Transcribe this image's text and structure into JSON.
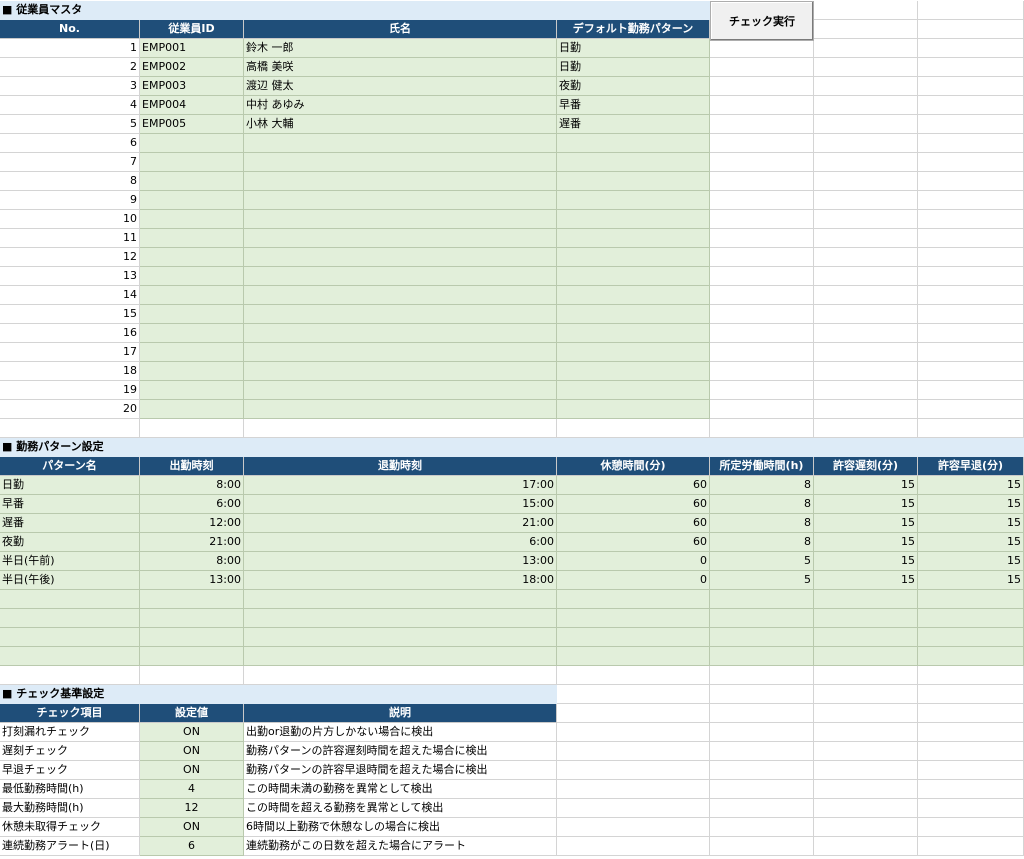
{
  "employee_section": {
    "title": "■ 従業員マスタ",
    "headers": [
      "No.",
      "従業員ID",
      "氏名",
      "デフォルト勤務パターン"
    ],
    "rows": [
      [
        "1",
        "EMP001",
        "鈴木 一郎",
        "日勤"
      ],
      [
        "2",
        "EMP002",
        "高橋 美咲",
        "日勤"
      ],
      [
        "3",
        "EMP003",
        "渡辺 健太",
        "夜勤"
      ],
      [
        "4",
        "EMP004",
        "中村 あゆみ",
        "早番"
      ],
      [
        "5",
        "EMP005",
        "小林 大輔",
        "遅番"
      ],
      [
        "6",
        "",
        "",
        ""
      ],
      [
        "7",
        "",
        "",
        ""
      ],
      [
        "8",
        "",
        "",
        ""
      ],
      [
        "9",
        "",
        "",
        ""
      ],
      [
        "10",
        "",
        "",
        ""
      ],
      [
        "11",
        "",
        "",
        ""
      ],
      [
        "12",
        "",
        "",
        ""
      ],
      [
        "13",
        "",
        "",
        ""
      ],
      [
        "14",
        "",
        "",
        ""
      ],
      [
        "15",
        "",
        "",
        ""
      ],
      [
        "16",
        "",
        "",
        ""
      ],
      [
        "17",
        "",
        "",
        ""
      ],
      [
        "18",
        "",
        "",
        ""
      ],
      [
        "19",
        "",
        "",
        ""
      ],
      [
        "20",
        "",
        "",
        ""
      ]
    ]
  },
  "check_button_label": "チェック実行",
  "pattern_section": {
    "title": "■ 勤務パターン設定",
    "headers": [
      "パターン名",
      "出勤時刻",
      "退勤時刻",
      "休憩時間(分)",
      "所定労働時間(h)",
      "許容遅刻(分)",
      "許容早退(分)"
    ],
    "rows": [
      [
        "日勤",
        "8:00",
        "17:00",
        "60",
        "8",
        "15",
        "15"
      ],
      [
        "早番",
        "6:00",
        "15:00",
        "60",
        "8",
        "15",
        "15"
      ],
      [
        "遅番",
        "12:00",
        "21:00",
        "60",
        "8",
        "15",
        "15"
      ],
      [
        "夜勤",
        "21:00",
        "6:00",
        "60",
        "8",
        "15",
        "15"
      ],
      [
        "半日(午前)",
        "8:00",
        "13:00",
        "0",
        "5",
        "15",
        "15"
      ],
      [
        "半日(午後)",
        "13:00",
        "18:00",
        "0",
        "5",
        "15",
        "15"
      ],
      [
        "",
        "",
        "",
        "",
        "",
        "",
        ""
      ],
      [
        "",
        "",
        "",
        "",
        "",
        "",
        ""
      ],
      [
        "",
        "",
        "",
        "",
        "",
        "",
        ""
      ],
      [
        "",
        "",
        "",
        "",
        "",
        "",
        ""
      ]
    ]
  },
  "criteria_section": {
    "title": "■ チェック基準設定",
    "headers": [
      "チェック項目",
      "設定値",
      "説明"
    ],
    "rows": [
      [
        "打刻漏れチェック",
        "ON",
        "出勤or退勤の片方しかない場合に検出"
      ],
      [
        "遅刻チェック",
        "ON",
        "勤務パターンの許容遅刻時間を超えた場合に検出"
      ],
      [
        "早退チェック",
        "ON",
        "勤務パターンの許容早退時間を超えた場合に検出"
      ],
      [
        "最低勤務時間(h)",
        "4",
        "この時間未満の勤務を異常として検出"
      ],
      [
        "最大勤務時間(h)",
        "12",
        "この時間を超える勤務を異常として検出"
      ],
      [
        "休憩未取得チェック",
        "ON",
        "6時間以上勤務で休憩なしの場合に検出"
      ],
      [
        "連続勤務アラート(日)",
        "6",
        "連続勤務がこの日数を超えた場合にアラート"
      ]
    ]
  }
}
